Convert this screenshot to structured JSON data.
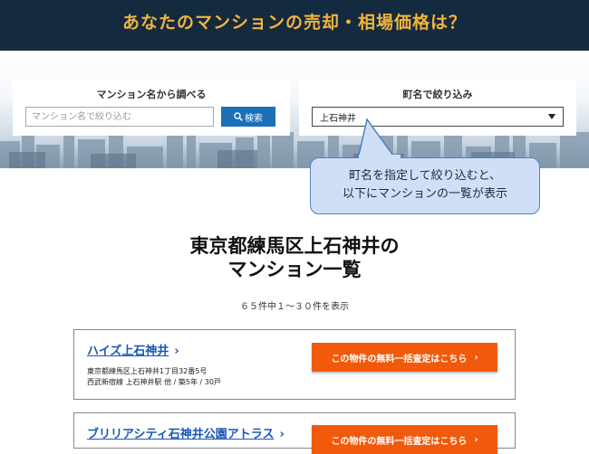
{
  "banner": {
    "title": "あなたのマンションの売却・相場価格は？"
  },
  "search_by_name": {
    "label": "マンション名から調べる",
    "placeholder": "マンション名で絞り込む",
    "button_label": "検索"
  },
  "filter_by_town": {
    "label": "町名で絞り込み",
    "selected": "上石神井"
  },
  "callout": {
    "line1": "町名を指定して絞り込むと、",
    "line2": "以下にマンションの一覧が表示"
  },
  "results": {
    "title_line1": "東京都練馬区上石神井の",
    "title_line2": "マンション一覧",
    "count_text": "６５件中１～３０件を表示"
  },
  "listings": [
    {
      "name": "ハイズ上石神井",
      "chevron": "›",
      "address": "東京都練馬区上石神井1丁目32番5号",
      "details": "西武新宿線 上石神井駅 他 / 築5年 / 30戸",
      "button_label": "この物件の無料一括査定はこちら",
      "button_chevron": "›"
    },
    {
      "name": "ブリリアシティ石神井公園アトラス",
      "chevron": "›",
      "button_label": "この物件の無料一括査定はこちら",
      "button_chevron": "›"
    }
  ],
  "colors": {
    "banner_bg": "#142a3e",
    "banner_text": "#f2b33d",
    "search_button": "#1a6fb8",
    "assess_button": "#f25a0b",
    "link": "#1a56b5"
  }
}
